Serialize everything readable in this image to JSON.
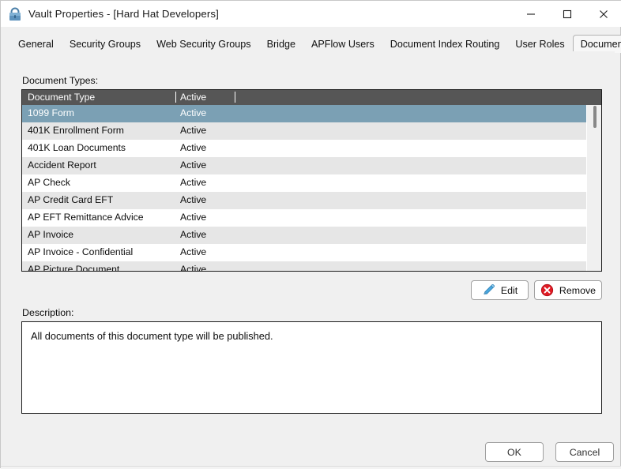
{
  "window": {
    "title": "Vault Properties - [Hard Hat Developers]",
    "lock_icon": "lock-icon",
    "controls": {
      "minimize": "minimize-icon",
      "maximize": "maximize-icon",
      "close": "close-icon"
    }
  },
  "tabs": [
    {
      "label": "General",
      "active": false
    },
    {
      "label": "Security Groups",
      "active": false
    },
    {
      "label": "Web Security Groups",
      "active": false
    },
    {
      "label": "Bridge",
      "active": false
    },
    {
      "label": "APFlow Users",
      "active": false
    },
    {
      "label": "Document Index Routing",
      "active": false
    },
    {
      "label": "User Roles",
      "active": false
    },
    {
      "label": "Document Publishing",
      "active": true
    }
  ],
  "labels": {
    "document_types": "Document Types:",
    "description": "Description:"
  },
  "list": {
    "columns": [
      "Document Type",
      "Active",
      ""
    ],
    "rows": [
      {
        "type": "1099 Form",
        "active": "Active",
        "selected": true
      },
      {
        "type": "401K Enrollment Form",
        "active": "Active",
        "selected": false
      },
      {
        "type": "401K Loan Documents",
        "active": "Active",
        "selected": false
      },
      {
        "type": "Accident Report",
        "active": "Active",
        "selected": false
      },
      {
        "type": "AP Check",
        "active": "Active",
        "selected": false
      },
      {
        "type": "AP Credit Card EFT",
        "active": "Active",
        "selected": false
      },
      {
        "type": "AP EFT Remittance Advice",
        "active": "Active",
        "selected": false
      },
      {
        "type": "AP Invoice",
        "active": "Active",
        "selected": false
      },
      {
        "type": "AP Invoice - Confidential",
        "active": "Active",
        "selected": false
      },
      {
        "type": "AP Picture Document",
        "active": "Active",
        "selected": false
      }
    ],
    "scrollbar": {
      "present": true
    }
  },
  "actions": {
    "edit": {
      "label": "Edit",
      "icon": "pencil-icon"
    },
    "remove": {
      "label": "Remove",
      "icon": "remove-circle-icon"
    }
  },
  "description": {
    "text": "All documents of this document type will be published."
  },
  "footer": {
    "ok": "OK",
    "cancel": "Cancel"
  },
  "colors": {
    "selection": "#7ba0b4",
    "header_bar": "#565656",
    "alt_row": "#e6e6e6",
    "panel": "#f0f0f0",
    "remove_icon": "#e01b24",
    "edit_icon": "#3da5e0"
  }
}
